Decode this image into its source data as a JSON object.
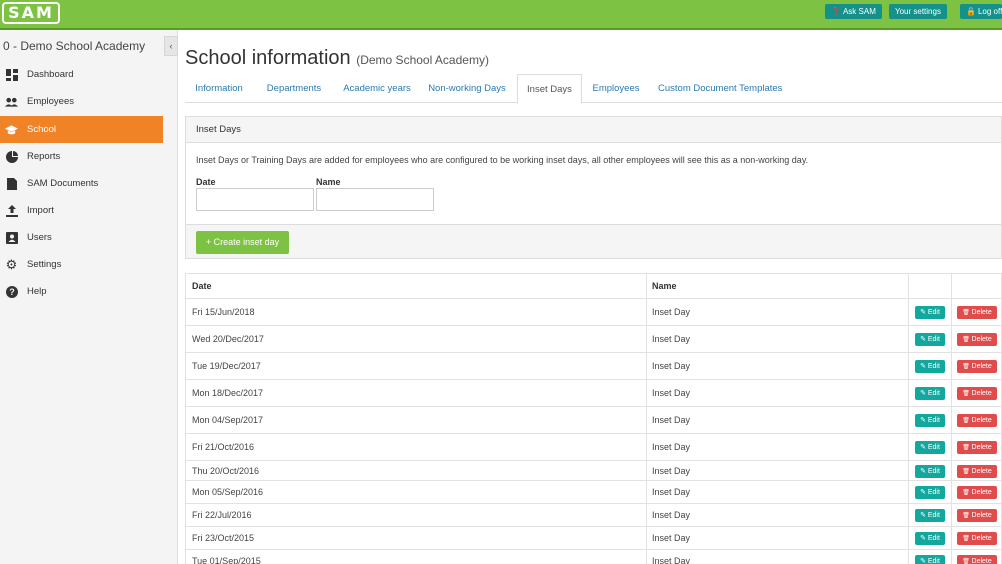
{
  "app": {
    "logo_text": "SAM"
  },
  "topbar": {
    "ask_label": "Ask SAM",
    "settings_label": "Your settings",
    "logoff_label": "Log off"
  },
  "sidebar": {
    "school_name": "0 - Demo School Academy",
    "items": [
      {
        "label": "Dashboard",
        "icon": "dashboard-icon"
      },
      {
        "label": "Employees",
        "icon": "people-icon"
      },
      {
        "label": "School",
        "icon": "graduation-cap-icon",
        "active": true
      },
      {
        "label": "Reports",
        "icon": "pie-chart-icon"
      },
      {
        "label": "SAM Documents",
        "icon": "document-icon"
      },
      {
        "label": "Import",
        "icon": "upload-icon"
      },
      {
        "label": "Users",
        "icon": "user-card-icon"
      },
      {
        "label": "Settings",
        "icon": "gear-icon"
      },
      {
        "label": "Help",
        "icon": "help-icon"
      }
    ]
  },
  "page": {
    "title": "School information",
    "subtitle": "(Demo School Academy)"
  },
  "tabs": [
    {
      "label": "Information"
    },
    {
      "label": "Departments"
    },
    {
      "label": "Academic years"
    },
    {
      "label": "Non-working Days"
    },
    {
      "label": "Inset Days",
      "active": true
    },
    {
      "label": "Employees"
    },
    {
      "label": "Custom Document Templates"
    }
  ],
  "panel": {
    "heading": "Inset Days",
    "description": "Inset Days or Training Days are added for employees who are configured to be working inset days, all other employees will see this as a non-working day.",
    "date_label": "Date",
    "date_value": "",
    "name_label": "Name",
    "name_value": "",
    "create_label": "Create inset day"
  },
  "table": {
    "columns": [
      "Date",
      "Name"
    ],
    "edit_label": "Edit",
    "delete_label": "Delete",
    "rows": [
      {
        "date": "Fri 15/Jun/2018",
        "name": "Inset Day"
      },
      {
        "date": "Wed 20/Dec/2017",
        "name": "Inset Day"
      },
      {
        "date": "Tue 19/Dec/2017",
        "name": "Inset Day"
      },
      {
        "date": "Mon 18/Dec/2017",
        "name": "Inset Day"
      },
      {
        "date": "Mon 04/Sep/2017",
        "name": "Inset Day"
      },
      {
        "date": "Fri 21/Oct/2016",
        "name": "Inset Day"
      },
      {
        "date": "Thu 20/Oct/2016",
        "name": "Inset Day"
      },
      {
        "date": "Mon 05/Sep/2016",
        "name": "Inset Day"
      },
      {
        "date": "Fri 22/Jul/2016",
        "name": "Inset Day"
      },
      {
        "date": "Fri 23/Oct/2015",
        "name": "Inset Day"
      },
      {
        "date": "Tue 01/Sep/2015",
        "name": "Inset Day"
      }
    ]
  },
  "colors": {
    "brand_green": "#7dc242",
    "teal": "#13918a",
    "active_orange": "#f08326",
    "delete_red": "#e04b4b",
    "link_blue": "#2a7ab0"
  }
}
